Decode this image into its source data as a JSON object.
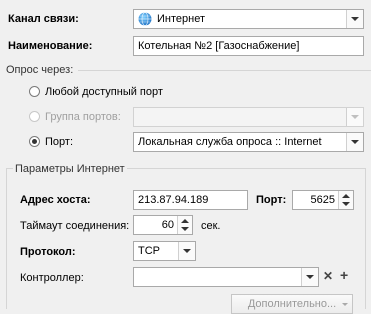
{
  "channel": {
    "label": "Канал связи:",
    "value": "Интернет",
    "icon": "globe-icon"
  },
  "name": {
    "label": "Наименование:",
    "value": "Котельная №2 [Газоснабжение]"
  },
  "poll": {
    "group_label": "Опрос через:",
    "any_port_label": "Любой доступный порт",
    "port_group_label": "Группа портов:",
    "port_label": "Порт:",
    "port_value": "Локальная служба опроса :: Internet"
  },
  "internet": {
    "group_label": "Параметры Интернет",
    "host_label": "Адрес хоста:",
    "host_value": "213.87.94.189",
    "port_label": "Порт:",
    "port_value": "5625",
    "timeout_label": "Таймаут соединения:",
    "timeout_value": "60",
    "timeout_unit": "сек.",
    "protocol_label": "Протокол:",
    "protocol_value": "TCP",
    "controller_label": "Контроллер:",
    "controller_value": "",
    "clear_symbol": "✕",
    "add_symbol": "+",
    "more_label": "Дополнительно..."
  }
}
